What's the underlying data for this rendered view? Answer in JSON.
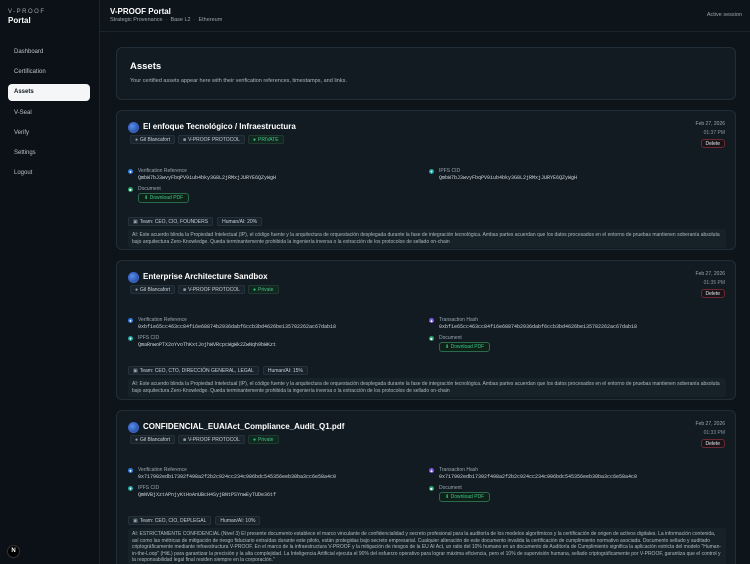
{
  "sidebar": {
    "brand_top": "V-PROOF",
    "brand_name": "Portal",
    "items": [
      {
        "label": "Dashboard"
      },
      {
        "label": "Certification"
      },
      {
        "label": "Assets"
      },
      {
        "label": "V-Seal"
      },
      {
        "label": "Verify"
      },
      {
        "label": "Settings"
      },
      {
        "label": "Logout"
      }
    ],
    "avatar_letter": "N"
  },
  "header": {
    "title": "V-PROOF Portal",
    "breadcrumb": [
      "Strategic Provenance",
      "Base L2",
      "Ethereum"
    ],
    "session": "Active session"
  },
  "assets": {
    "title": "Assets",
    "subtitle": "Your certified assets appear here with their verification references, timestamps, and links."
  },
  "cards": [
    {
      "title": "El enfoque Tecnológico / Infraestructura",
      "owner": "Gil Blancafort",
      "protocol": "V-PROOF PROTOCOL",
      "visibility": "PRIVATE",
      "date": "Feb 27, 2026",
      "time": "01:37 PM",
      "delete_label": "Delete",
      "verification_label": "Verification Reference",
      "verification_value": "QmbW7bJ3wvyFbqPV9iub4bky3G8L2jRMxjJURYE6QZyWgH",
      "ipfs_label": "IPFS CID",
      "ipfs_value": "QmbW7bJ3wvyFbqPV9iub4bky3G8L2jRMxjJURYE6QZyWgH",
      "document_label": "Document",
      "download_label": "Download PDF",
      "team": "Team: CEO, CIO, FOUNDERS",
      "ratio": "Human/AI: 20%",
      "note": "AI: Este acuerdo blinda la Propiedad Intelectual (IP), el código fuente y la arquitectura de orquestación desplegada durante la fase de integración tecnológica. Ambas partes acuerdan que los datos procesados en el entorno de pruebas mantienen soberanía absoluta bajo arquitectura Zero-Knowledge. Queda terminantemente prohibida la ingeniería inversa o la extracción de los protocolos de sellado on-chain"
    },
    {
      "title": "Enterprise Architecture Sandbox",
      "owner": "Gil Blancafort",
      "protocol": "V-PROOF PROTOCOL",
      "visibility": "Private",
      "date": "Feb 27, 2026",
      "time": "01:35 PM",
      "delete_label": "Delete",
      "verification_label": "Verification Reference",
      "verification_value": "0xbf1e65cc463cc84f16e68874b2936dabf6ccb3bd4626be135782262ac67dab18",
      "tx_label": "Transaction Hash",
      "tx_value": "0xbf1e65cc463cc84f16e68874b2936dabf6ccb3bd4626be135782262ac67dab18",
      "ipfs_label": "IPFS CID",
      "ipfs_value": "QmaRnwoPTX2oYvoThKxtJojhWVRcpcWgWk2ZwNqh9bWKzt",
      "document_label": "Document",
      "download_label": "Download PDF",
      "team": "Team: CEO, CTO, DIRECCIÓN GENERAL, LEGAL",
      "ratio": "Human/AI: 15%",
      "note": "AI: Este acuerdo blinda la Propiedad Intelectual (IP), el código fuente y la arquitectura de orquestación desplegada durante la fase de integración tecnológica. Ambas partes acuerdan que los datos procesados en el entorno de pruebas mantienen soberanía absoluta bajo arquitectura Zero-Knowledge. Queda terminantemente prohibida la ingeniería inversa o la extracción de los protocolos de sellado on-chain"
    },
    {
      "title": "CONFIDENCIAL_EUAIAct_Compliance_Audit_Q1.pdf",
      "owner": "Gil Blancafort",
      "protocol": "V-PROOF PROTOCOL",
      "visibility": "Private",
      "date": "Feb 27, 2026",
      "time": "01:33 PM",
      "delete_label": "Delete",
      "verification_label": "Verification Reference",
      "verification_value": "0x717902edb17392f498a2f2b2c924cc234c906bdc545356eeb30ba3cc6e58a4c0",
      "tx_label": "Transaction Hash",
      "tx_value": "0x717902edb17392f498a2f2b2c924cc234c906bdc545356eeb30ba3cc6e58a4c0",
      "ipfs_label": "IPFS CID",
      "ipfs_value": "QmNVBjXztAPnjyKtHoAnUBcH4SyjBNtPSYnwEyTUDe36tf",
      "document_label": "Document",
      "download_label": "Download PDF",
      "team": "Team: CEO, CIO, DEPLEGAL",
      "ratio": "Human/AI: 10%",
      "note": "AI: ESTRICTAMENTE CONFIDENCIAL (Nivel 3) El presente documento establece el marco vinculante de confidencialidad y secreto profesional para la auditoría de los modelos algorítmicos y la certificación de origen de activos digitales. La información contenida, así como las métricas de mitigación de riesgo fiduciario extraídas durante este piloto, están protegidas bajo secreto empresarial. Cualquier alteración de este documento invalida la certificación de cumplimiento normativo asociada. Documento sellado y auditado criptográficamente mediante infraestructura V-PROOF. En el marco de la infraestructura V-PROOF y la mitigación de riesgos de la EU AI Act, un ratio del 10% humano en un documento de Auditoría de Cumplimiento significa la aplicación estricta del modelo \"Human-in-the-Loop\" (HitL) para garantizar la precisión y la alta complejidad. La Inteligencia Artificial ejecuta el 90% del esfuerzo operativo para lograr máxima eficiencia, pero el 10% de supervisión humana, sellado criptográficamente por V-PROOF, garantiza que el control y la responsabilidad legal final residen siempre en la corporación.\""
    }
  ]
}
